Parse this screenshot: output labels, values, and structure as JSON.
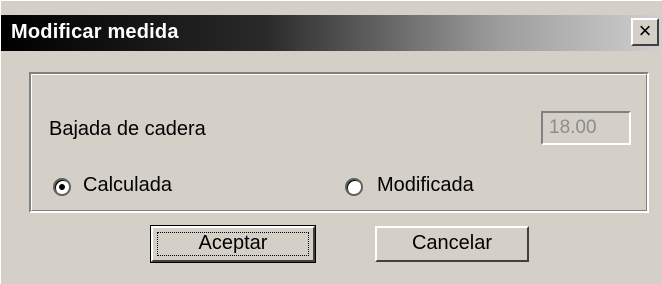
{
  "window": {
    "title": "Modificar medida",
    "close_glyph": "×"
  },
  "group": {
    "field_label": "Bajada de cadera",
    "field_value": "18.00",
    "radio_calculada": {
      "label": "Calculada",
      "checked": true
    },
    "radio_modificada": {
      "label": "Modificada",
      "checked": false
    }
  },
  "buttons": {
    "accept_label": "Aceptar",
    "cancel_label": "Cancelar"
  },
  "colors": {
    "face": "#d4d0c8",
    "disabled_text": "#8c8c8c"
  }
}
